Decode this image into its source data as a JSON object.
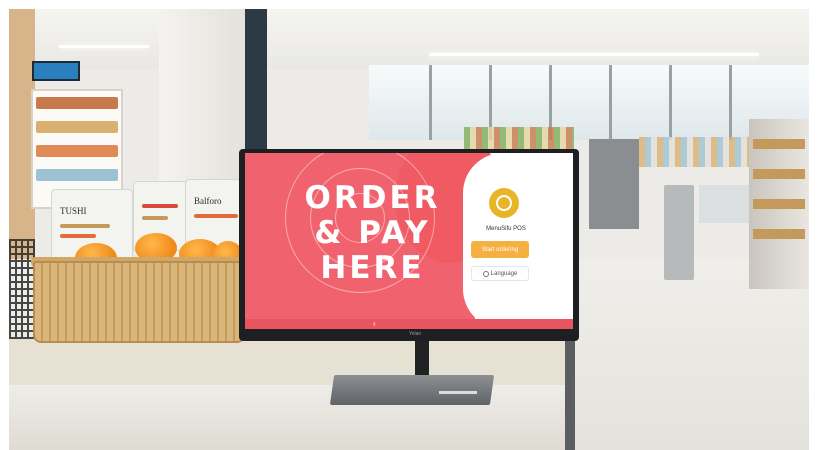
{
  "kiosk": {
    "hero_line1": "ORDER",
    "hero_line2": "& PAY",
    "hero_line3": "HERE",
    "app_name": "MenuSifu POS",
    "start_button_label": "Start ordering",
    "language_button_label": "Language",
    "bezel_brand": "Yelan"
  },
  "products": {
    "bag1_label": "TUSHI",
    "bag2_label": "Balforo"
  },
  "colors": {
    "screen_accent": "#f0636e",
    "start_button": "#f6b042",
    "logo": "#e8b52a"
  },
  "icons": {
    "logo": "menusifu-logo-icon",
    "globe": "globe-icon",
    "nav": "chevron-left-icon"
  }
}
